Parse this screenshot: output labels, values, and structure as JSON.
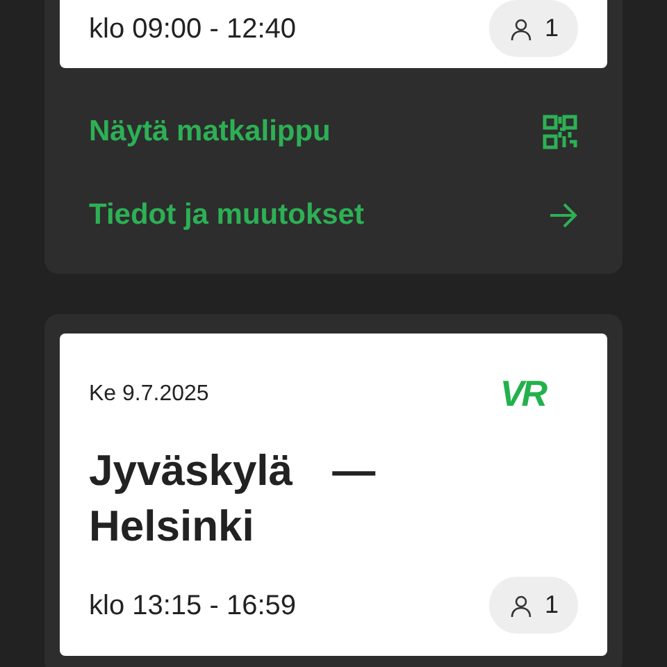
{
  "trips": [
    {
      "time": "klo 09:00 - 12:40",
      "passengers": "1",
      "actions": [
        {
          "label": "Näytä matkalippu",
          "kind": "qr"
        },
        {
          "label": "Tiedot ja muutokset",
          "kind": "arrow"
        }
      ]
    },
    {
      "date": "Ke 9.7.2025",
      "logo": "VR",
      "route": "Jyväskylä — Helsinki",
      "time": "klo 13:15 - 16:59",
      "passengers": "1"
    }
  ]
}
